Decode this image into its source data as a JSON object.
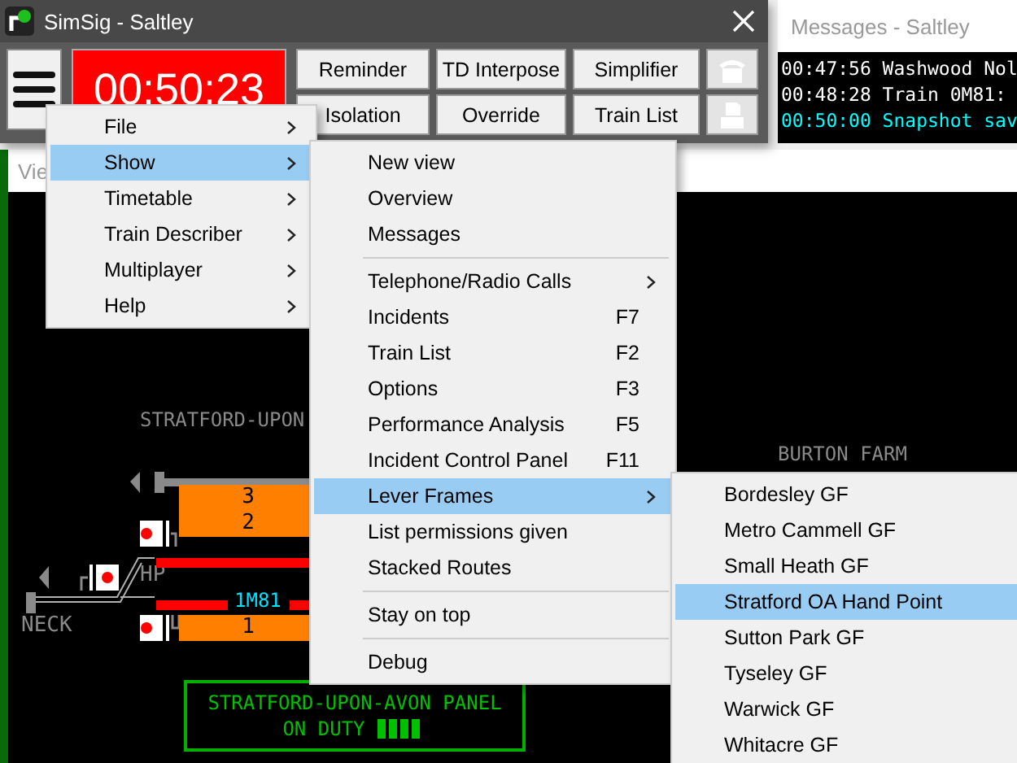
{
  "main_window": {
    "title": "SimSig - Saltley",
    "clock": "00:50:23",
    "buttons": [
      {
        "label": "Reminder",
        "kind": "text"
      },
      {
        "label": "TD Interpose",
        "kind": "text"
      },
      {
        "label": "Simplifier",
        "kind": "text"
      },
      {
        "kind": "phone",
        "disabled": true
      },
      {
        "label": "Isolation",
        "kind": "text"
      },
      {
        "label": "Override",
        "kind": "text"
      },
      {
        "label": "Train List",
        "kind": "text"
      },
      {
        "kind": "printer",
        "disabled": true
      }
    ]
  },
  "messages_window": {
    "title": "Messages - Saltley",
    "lines": [
      {
        "text": "00:47:56 Washwood Nol",
        "color": "#ffffff"
      },
      {
        "text": "00:48:28 Train 0M81:",
        "color": "#ffffff"
      },
      {
        "text": "00:50:00 Snapshot sav",
        "color": "#00ffff"
      }
    ]
  },
  "view_window": {
    "title": "Vie"
  },
  "panel": {
    "labels": [
      {
        "text": "STRATFORD-UPON",
        "kind": "area"
      },
      {
        "text": "BURTON FARM",
        "kind": "area"
      },
      {
        "text": "HP",
        "kind": "small"
      },
      {
        "text": "NECK",
        "kind": "small"
      }
    ],
    "platforms": [
      {
        "numbers": [
          "3",
          "2"
        ]
      },
      {
        "numbers": [
          "1"
        ]
      }
    ],
    "train_id": "1M81",
    "duty_box": {
      "lines": [
        "STRATFORD-UPON-AVON PANEL",
        "ON DUTY"
      ]
    }
  },
  "main_menu": [
    {
      "label": "File",
      "submenu": true,
      "selected": false
    },
    {
      "label": "Show",
      "submenu": true,
      "selected": true
    },
    {
      "label": "Timetable",
      "submenu": true,
      "selected": false
    },
    {
      "label": "Train Describer",
      "submenu": true,
      "selected": false
    },
    {
      "label": "Multiplayer",
      "submenu": true,
      "selected": false
    },
    {
      "label": "Help",
      "submenu": true,
      "selected": false
    }
  ],
  "show_menu": [
    {
      "kind": "item",
      "label": "New view",
      "selected": false
    },
    {
      "kind": "item",
      "label": "Overview",
      "selected": false
    },
    {
      "kind": "item",
      "label": "Messages",
      "selected": false
    },
    {
      "kind": "separator"
    },
    {
      "kind": "item",
      "label": "Telephone/Radio Calls",
      "submenu": true,
      "selected": false
    },
    {
      "kind": "item",
      "label": "Incidents",
      "shortcut": "F7",
      "selected": false
    },
    {
      "kind": "item",
      "label": "Train List",
      "shortcut": "F2",
      "selected": false
    },
    {
      "kind": "item",
      "label": "Options",
      "shortcut": "F3",
      "selected": false
    },
    {
      "kind": "item",
      "label": "Performance Analysis",
      "shortcut": "F5",
      "selected": false
    },
    {
      "kind": "item",
      "label": "Incident Control Panel",
      "shortcut": "F11",
      "selected": false
    },
    {
      "kind": "item",
      "label": "Lever Frames",
      "submenu": true,
      "selected": true
    },
    {
      "kind": "item",
      "label": "List permissions given",
      "selected": false
    },
    {
      "kind": "item",
      "label": "Stacked Routes",
      "selected": false
    },
    {
      "kind": "separator"
    },
    {
      "kind": "item",
      "label": "Stay on top",
      "selected": false
    },
    {
      "kind": "separator"
    },
    {
      "kind": "item",
      "label": "Debug",
      "selected": false
    }
  ],
  "lever_frames_menu": [
    {
      "label": "Bordesley GF",
      "selected": false
    },
    {
      "label": "Metro Cammell GF",
      "selected": false
    },
    {
      "label": "Small Heath GF",
      "selected": false
    },
    {
      "label": "Stratford OA Hand Point",
      "selected": true
    },
    {
      "label": "Sutton Park GF",
      "selected": false
    },
    {
      "label": "Tyseley GF",
      "selected": false
    },
    {
      "label": "Warwick GF",
      "selected": false
    },
    {
      "label": "Whitacre GF",
      "selected": false
    }
  ]
}
